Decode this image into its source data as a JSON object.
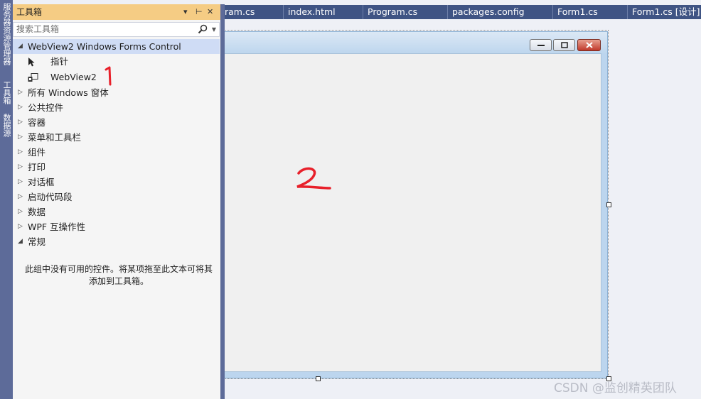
{
  "side_tabs": [
    "服务器资源管理器",
    "工具箱",
    "数据源"
  ],
  "doc_tabs": [
    "ram.cs",
    "index.html",
    "Program.cs",
    "packages.config",
    "Form1.cs",
    "Form1.cs [设计]"
  ],
  "toolbox": {
    "title": "工具箱",
    "search_placeholder": "搜索工具箱",
    "header_icons": {
      "dropdown": "▾",
      "pin": "⊢",
      "close": "✕"
    },
    "selected_group": "WebView2 Windows Forms Control",
    "items": [
      {
        "label": "指针",
        "icon": "pointer-icon"
      },
      {
        "label": "WebView2",
        "icon": "webview2-icon"
      }
    ],
    "groups": [
      "所有 Windows 窗体",
      "公共控件",
      "容器",
      "菜单和工具栏",
      "组件",
      "打印",
      "对话框",
      "启动代码段",
      "数据",
      "WPF 互操作性",
      "常规"
    ],
    "empty_message_line1": "此组中没有可用的控件。将某项拖至此文本可将其",
    "empty_message_line2": "添加到工具箱。"
  },
  "annotations": {
    "one": "1",
    "two": "2"
  },
  "watermark": "CSDN @监创精英团队",
  "colors": {
    "accent_header": "#f5cc84",
    "tab_bar": "#3f5484",
    "side_strip": "#5d6b99",
    "annotation_red": "#e8202a"
  }
}
